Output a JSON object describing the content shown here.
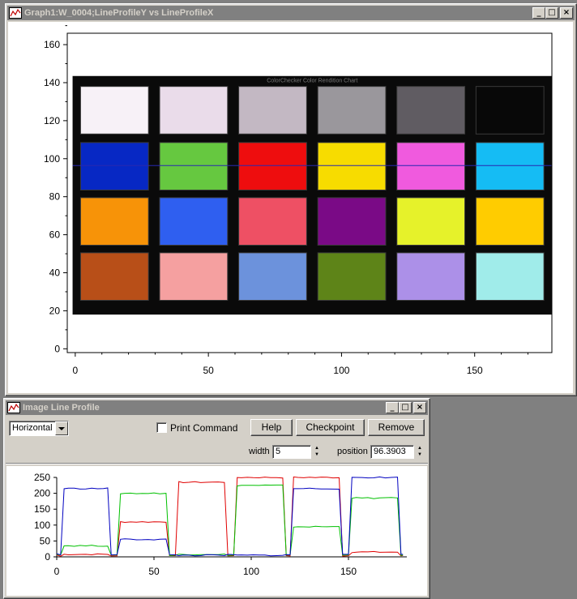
{
  "graph_window": {
    "title": "Graph1:W_0004;LineProfileY vs LineProfileX",
    "y_ticks": [
      "0",
      "20",
      "40",
      "60",
      "80",
      "100",
      "120",
      "140",
      "160"
    ],
    "x_ticks": [
      "0",
      "50",
      "100",
      "150"
    ],
    "image_caption": "ColorChecker Color Rendition Chart",
    "profile_line_y": 96.3903,
    "swatch_colors": [
      [
        "#f7f1f7",
        "#eadcea",
        "#c3b8c3",
        "#9a979c",
        "#605c62",
        "#080808"
      ],
      [
        "#0728c4",
        "#66c840",
        "#ee0d0e",
        "#f7dc00",
        "#f05ade",
        "#15bcf4"
      ],
      [
        "#f79308",
        "#2f5ff0",
        "#ee5064",
        "#7a0a86",
        "#e6f22a",
        "#ffcc00"
      ],
      [
        "#b84f18",
        "#f5a0a0",
        "#6c92dc",
        "#5e8418",
        "#ac90e8",
        "#a0ecea"
      ]
    ]
  },
  "profile_window": {
    "title": "Image Line Profile",
    "orientation": "Horizontal",
    "print_command_label": "Print Command",
    "print_command_checked": false,
    "help_label": "Help",
    "checkpoint_label": "Checkpoint",
    "remove_label": "Remove",
    "width_label": "width",
    "width_value": "5",
    "position_label": "position",
    "position_value": "96.3903",
    "chart_y_ticks": [
      "0",
      "50",
      "100",
      "150",
      "200",
      "250"
    ],
    "chart_x_ticks": [
      "0",
      "50",
      "100",
      "150"
    ]
  },
  "chart_data": {
    "type": "line",
    "xlim": [
      0,
      180
    ],
    "ylim": [
      0,
      250
    ],
    "swatch_ranges": [
      [
        3,
        27
      ],
      [
        32,
        57
      ],
      [
        62,
        87
      ],
      [
        92,
        117
      ],
      [
        121,
        146
      ],
      [
        151,
        176
      ]
    ],
    "series": [
      {
        "color": "#e00000",
        "levels": [
          8,
          110,
          235,
          250,
          250,
          15
        ]
      },
      {
        "color": "#00c000",
        "levels": [
          35,
          200,
          8,
          225,
          95,
          185
        ]
      },
      {
        "color": "#0000c0",
        "levels": [
          215,
          55,
          5,
          5,
          215,
          250
        ]
      }
    ],
    "grid": false
  }
}
